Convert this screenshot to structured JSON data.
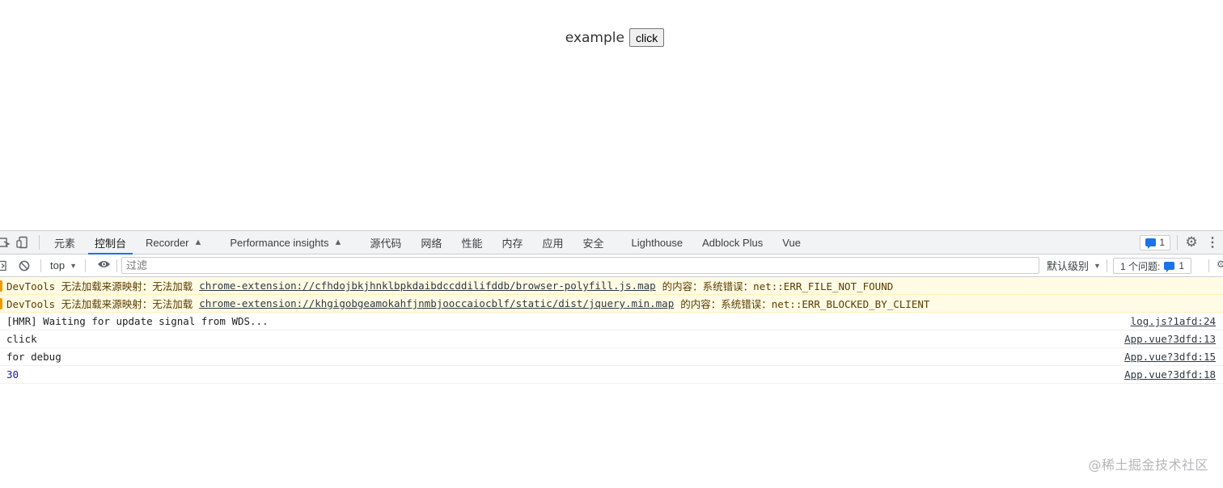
{
  "page": {
    "example_label": "example",
    "button_label": "click"
  },
  "devtools": {
    "tabs": [
      {
        "label": "元素"
      },
      {
        "label": "控制台"
      },
      {
        "label": "Recorder"
      },
      {
        "label": "Performance insights"
      },
      {
        "label": "源代码"
      },
      {
        "label": "网络"
      },
      {
        "label": "性能"
      },
      {
        "label": "内存"
      },
      {
        "label": "应用"
      },
      {
        "label": "安全"
      },
      {
        "label": "Lighthouse"
      },
      {
        "label": "Adblock Plus"
      },
      {
        "label": "Vue"
      }
    ],
    "message_count": "1",
    "toolbar": {
      "context": "top",
      "filter_placeholder": "过滤",
      "levels": "默认级别",
      "issues_label": "1 个问题:",
      "issues_count": "1"
    },
    "console": {
      "warnings": [
        {
          "prefix": "DevTools 无法加载来源映射：无法加载",
          "url": "chrome-extension://cfhdojbkjhnklbpkdaibdccddilifddb/browser-polyfill.js.map",
          "suffix": "的内容：系统错误：net::ERR_FILE_NOT_FOUND"
        },
        {
          "prefix": "DevTools 无法加载来源映射：无法加载",
          "url": "chrome-extension://khgigobgeamokahfjnmbjooccaiocblf/static/dist/jquery.min.map",
          "suffix": "的内容：系统错误：net::ERR_BLOCKED_BY_CLIENT"
        }
      ],
      "logs": [
        {
          "text": "[HMR] Waiting for update signal from WDS...",
          "source": "log.js?1afd:24"
        },
        {
          "text": "click",
          "source": "App.vue?3dfd:13"
        },
        {
          "text": "for debug",
          "source": "App.vue?3dfd:15"
        },
        {
          "text": "30",
          "source": "App.vue?3dfd:18"
        }
      ]
    }
  },
  "watermark": "@稀土掘金技术社区"
}
